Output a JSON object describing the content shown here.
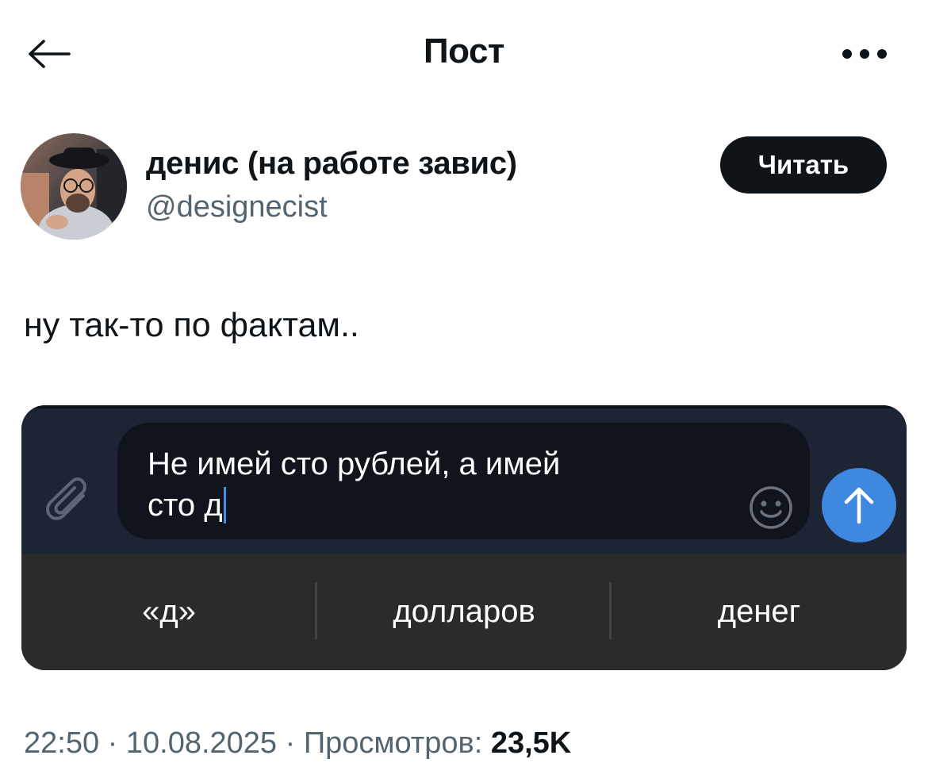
{
  "header": {
    "title": "Пост",
    "back_icon": "arrow-left-icon",
    "more_icon": "more-horizontal-icon"
  },
  "author": {
    "name": "денис (на работе завис)",
    "handle": "@designecist",
    "follow_label": "Читать"
  },
  "post": {
    "text": "ну так-то по фактам.."
  },
  "media": {
    "input_text_line1": "Не имей сто рублей, а имей",
    "input_text_line2": "сто д",
    "suggestions": [
      "«д»",
      "долларов",
      "денег"
    ],
    "attach_icon": "paperclip-icon",
    "emoji_icon": "smile-icon",
    "send_icon": "arrow-up-icon",
    "colors": {
      "composer_bg": "#1d2433",
      "input_bg": "#0f141d",
      "keyboard_bg": "#2b2b2d",
      "send_button": "#3e88e0",
      "caret": "#4a8ee4"
    }
  },
  "meta": {
    "time": "22:50",
    "separator": " · ",
    "date": "10.08.2025",
    "views_label": "Просмотров:",
    "views_count": "23,5K"
  },
  "colors": {
    "text_primary": "#0f1419",
    "text_secondary": "#536471",
    "follow_button": "#0f1419"
  }
}
